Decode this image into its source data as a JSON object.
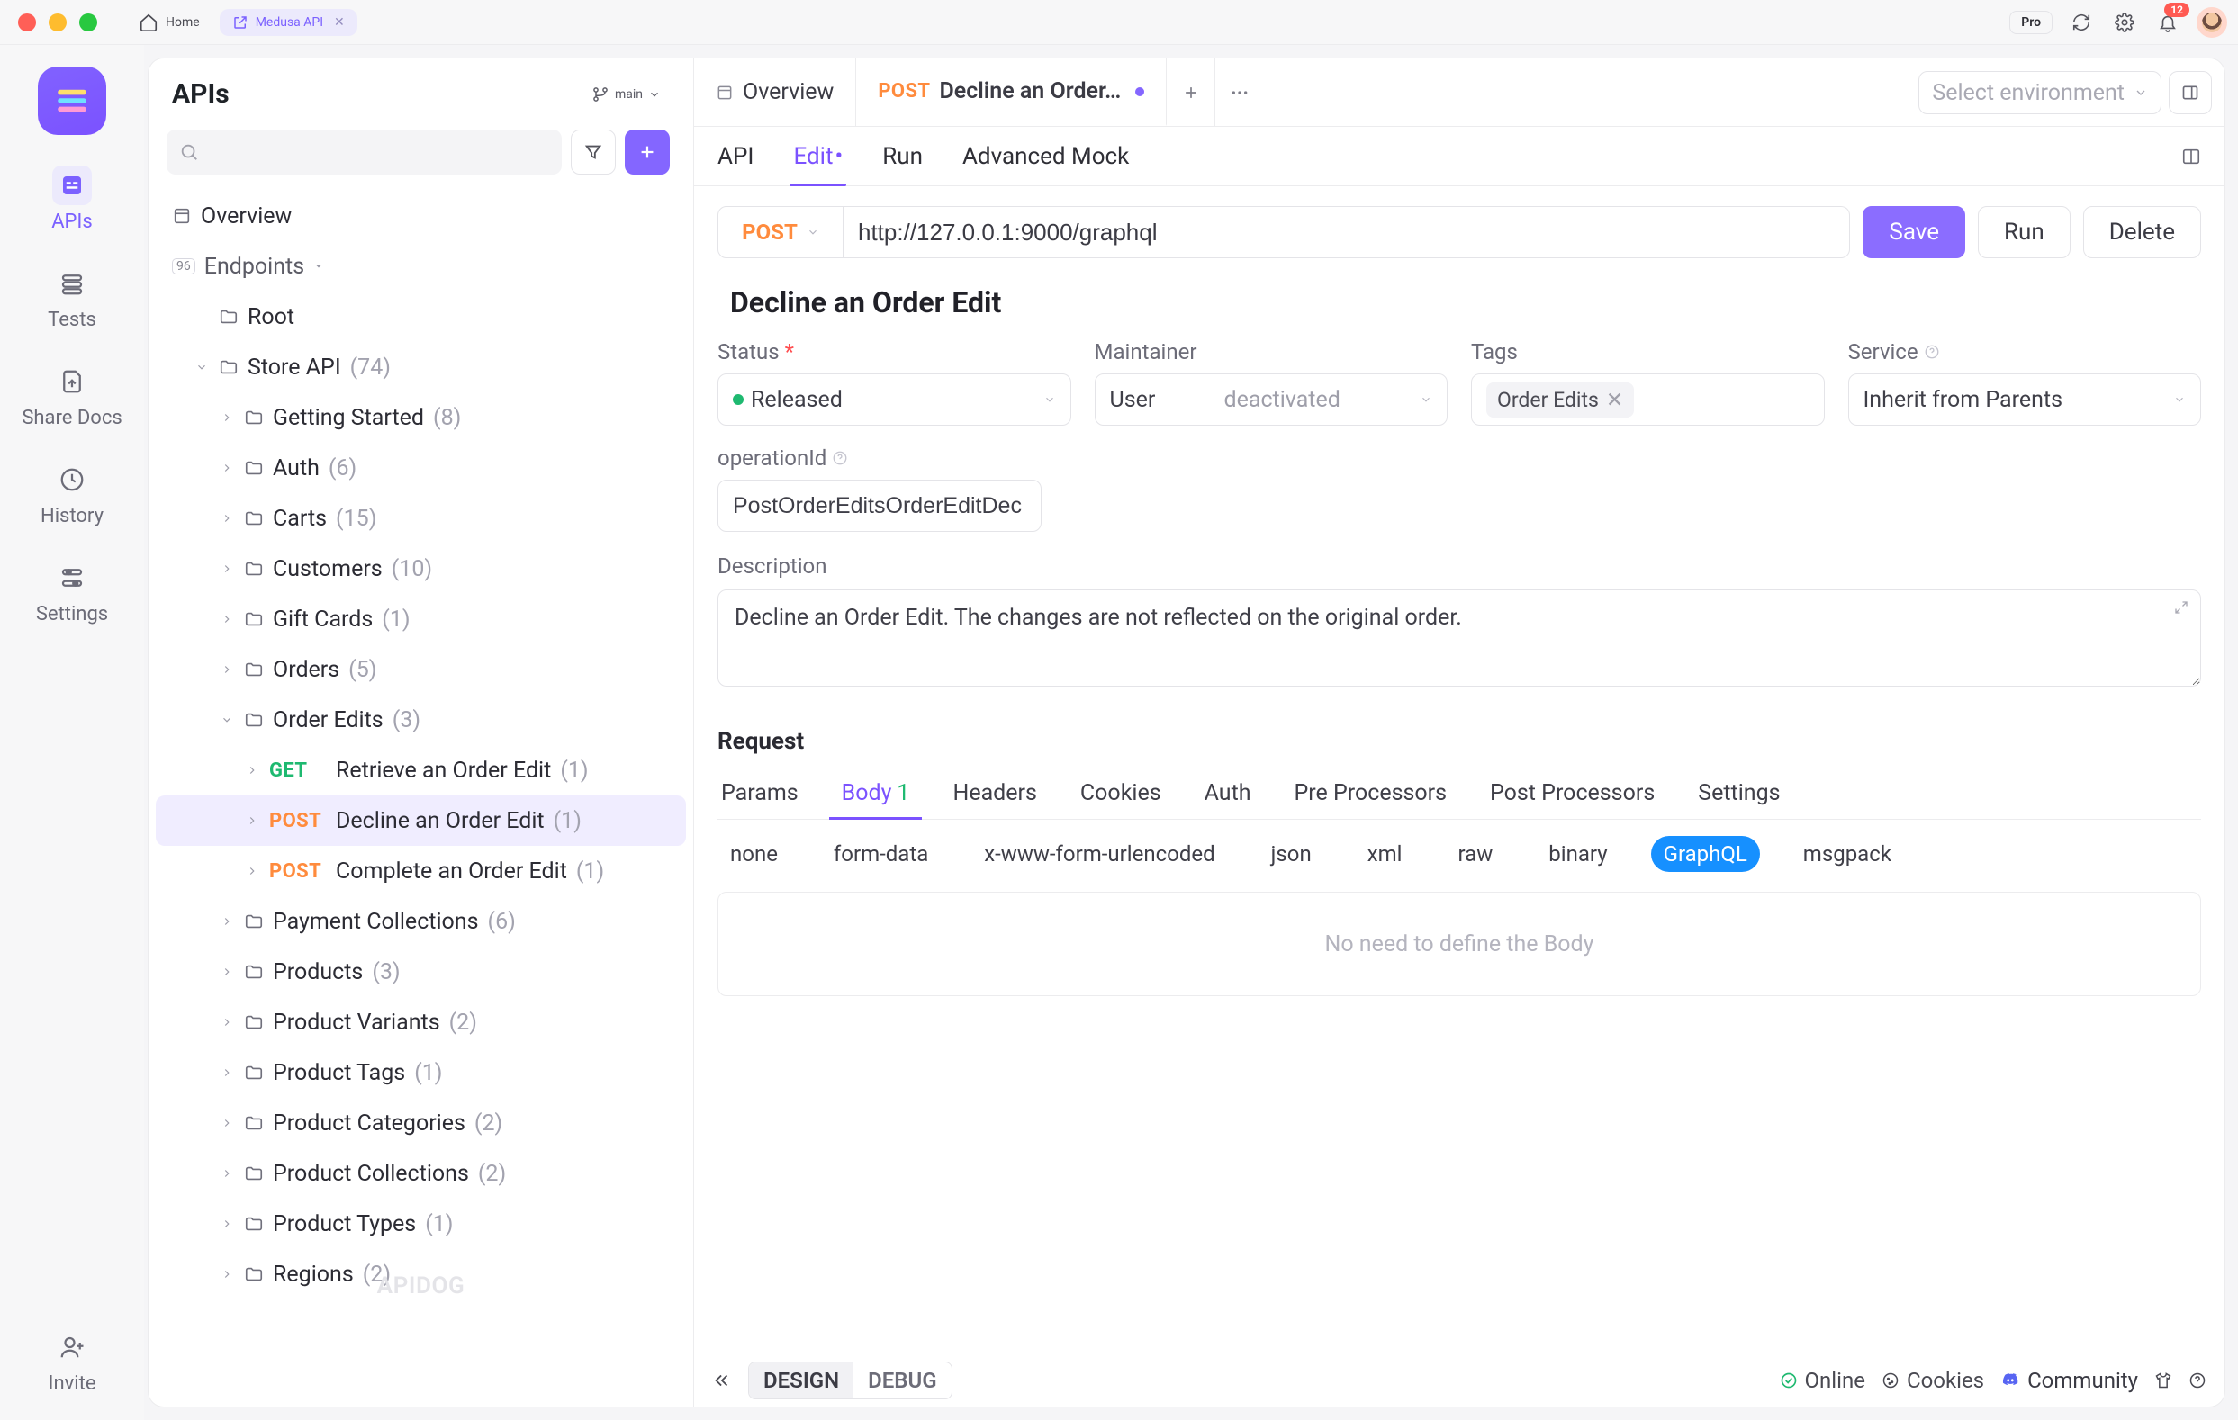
{
  "titlebar": {
    "home_label": "Home",
    "tab_label": "Medusa API"
  },
  "header_controls": {
    "pro_label": "Pro",
    "notification_count": "12"
  },
  "rail": {
    "items": [
      {
        "label": "APIs",
        "icon": "apis"
      },
      {
        "label": "Tests",
        "icon": "tests"
      },
      {
        "label": "Share Docs",
        "icon": "share"
      },
      {
        "label": "History",
        "icon": "history"
      },
      {
        "label": "Settings",
        "icon": "settings"
      }
    ],
    "invite_label": "Invite"
  },
  "sidebar": {
    "title": "APIs",
    "branch": "main",
    "overview_label": "Overview",
    "endpoints_label": "Endpoints",
    "endpoints_badge": "96",
    "tree": [
      {
        "depth": 1,
        "icon": "folder",
        "chev": "none",
        "label": "Root",
        "count": ""
      },
      {
        "depth": 1,
        "icon": "folder",
        "chev": "down",
        "label": "Store API",
        "count": "(74)"
      },
      {
        "depth": 2,
        "icon": "folder",
        "chev": "right",
        "label": "Getting Started",
        "count": "(8)"
      },
      {
        "depth": 2,
        "icon": "folder",
        "chev": "right",
        "label": "Auth",
        "count": "(6)"
      },
      {
        "depth": 2,
        "icon": "folder",
        "chev": "right",
        "label": "Carts",
        "count": "(15)"
      },
      {
        "depth": 2,
        "icon": "folder",
        "chev": "right",
        "label": "Customers",
        "count": "(10)"
      },
      {
        "depth": 2,
        "icon": "folder",
        "chev": "right",
        "label": "Gift Cards",
        "count": "(1)"
      },
      {
        "depth": 2,
        "icon": "folder",
        "chev": "right",
        "label": "Orders",
        "count": "(5)"
      },
      {
        "depth": 2,
        "icon": "folder",
        "chev": "down",
        "label": "Order Edits",
        "count": "(3)"
      },
      {
        "depth": 3,
        "icon": "endpoint",
        "chev": "right",
        "method": "GET",
        "label": "Retrieve an Order Edit",
        "count": "(1)"
      },
      {
        "depth": 3,
        "icon": "endpoint",
        "chev": "right",
        "method": "POST",
        "label": "Decline an Order Edit",
        "count": "(1)",
        "selected": true
      },
      {
        "depth": 3,
        "icon": "endpoint",
        "chev": "right",
        "method": "POST",
        "label": "Complete an Order Edit",
        "count": "(1)"
      },
      {
        "depth": 2,
        "icon": "folder",
        "chev": "right",
        "label": "Payment Collections",
        "count": "(6)"
      },
      {
        "depth": 2,
        "icon": "folder",
        "chev": "right",
        "label": "Products",
        "count": "(3)"
      },
      {
        "depth": 2,
        "icon": "folder",
        "chev": "right",
        "label": "Product Variants",
        "count": "(2)"
      },
      {
        "depth": 2,
        "icon": "folder",
        "chev": "right",
        "label": "Product Tags",
        "count": "(1)"
      },
      {
        "depth": 2,
        "icon": "folder",
        "chev": "right",
        "label": "Product Categories",
        "count": "(2)"
      },
      {
        "depth": 2,
        "icon": "folder",
        "chev": "right",
        "label": "Product Collections",
        "count": "(2)"
      },
      {
        "depth": 2,
        "icon": "folder",
        "chev": "right",
        "label": "Product Types",
        "count": "(1)"
      },
      {
        "depth": 2,
        "icon": "folder",
        "chev": "right",
        "label": "Regions",
        "count": "(2)"
      }
    ],
    "watermark": "APIDOG"
  },
  "tabs": {
    "overview_label": "Overview",
    "active_method": "POST",
    "active_label": "Decline an Order…",
    "env_placeholder": "Select environment"
  },
  "subtabs": {
    "api": "API",
    "edit": "Edit",
    "run": "Run",
    "mock": "Advanced Mock"
  },
  "url_row": {
    "method": "POST",
    "url": "http://127.0.0.1:9000/graphql",
    "save": "Save",
    "run": "Run",
    "delete": "Delete"
  },
  "endpoint_title": "Decline an Order Edit",
  "fields": {
    "status_label": "Status",
    "status_value": "Released",
    "maintainer_label": "Maintainer",
    "maintainer_value": "User",
    "maintainer_state": "deactivated",
    "tags_label": "Tags",
    "tag_value": "Order Edits",
    "service_label": "Service",
    "service_value": "Inherit from Parents",
    "opid_label": "operationId",
    "opid_value": "PostOrderEditsOrderEditDec",
    "desc_label": "Description",
    "desc_value": "Decline an Order Edit. The changes are not reflected on the original order."
  },
  "request": {
    "title": "Request",
    "tabs": {
      "params": "Params",
      "body": "Body",
      "body_count": "1",
      "headers": "Headers",
      "cookies": "Cookies",
      "auth": "Auth",
      "pre": "Pre Processors",
      "post": "Post Processors",
      "settings": "Settings"
    },
    "body_types": {
      "none": "none",
      "form": "form-data",
      "xwww": "x-www-form-urlencoded",
      "json": "json",
      "xml": "xml",
      "raw": "raw",
      "binary": "binary",
      "graphql": "GraphQL",
      "msgpack": "msgpack"
    },
    "placeholder": "No need to define the Body"
  },
  "footer": {
    "design": "DESIGN",
    "debug": "DEBUG",
    "online": "Online",
    "cookies": "Cookies",
    "community": "Community"
  }
}
